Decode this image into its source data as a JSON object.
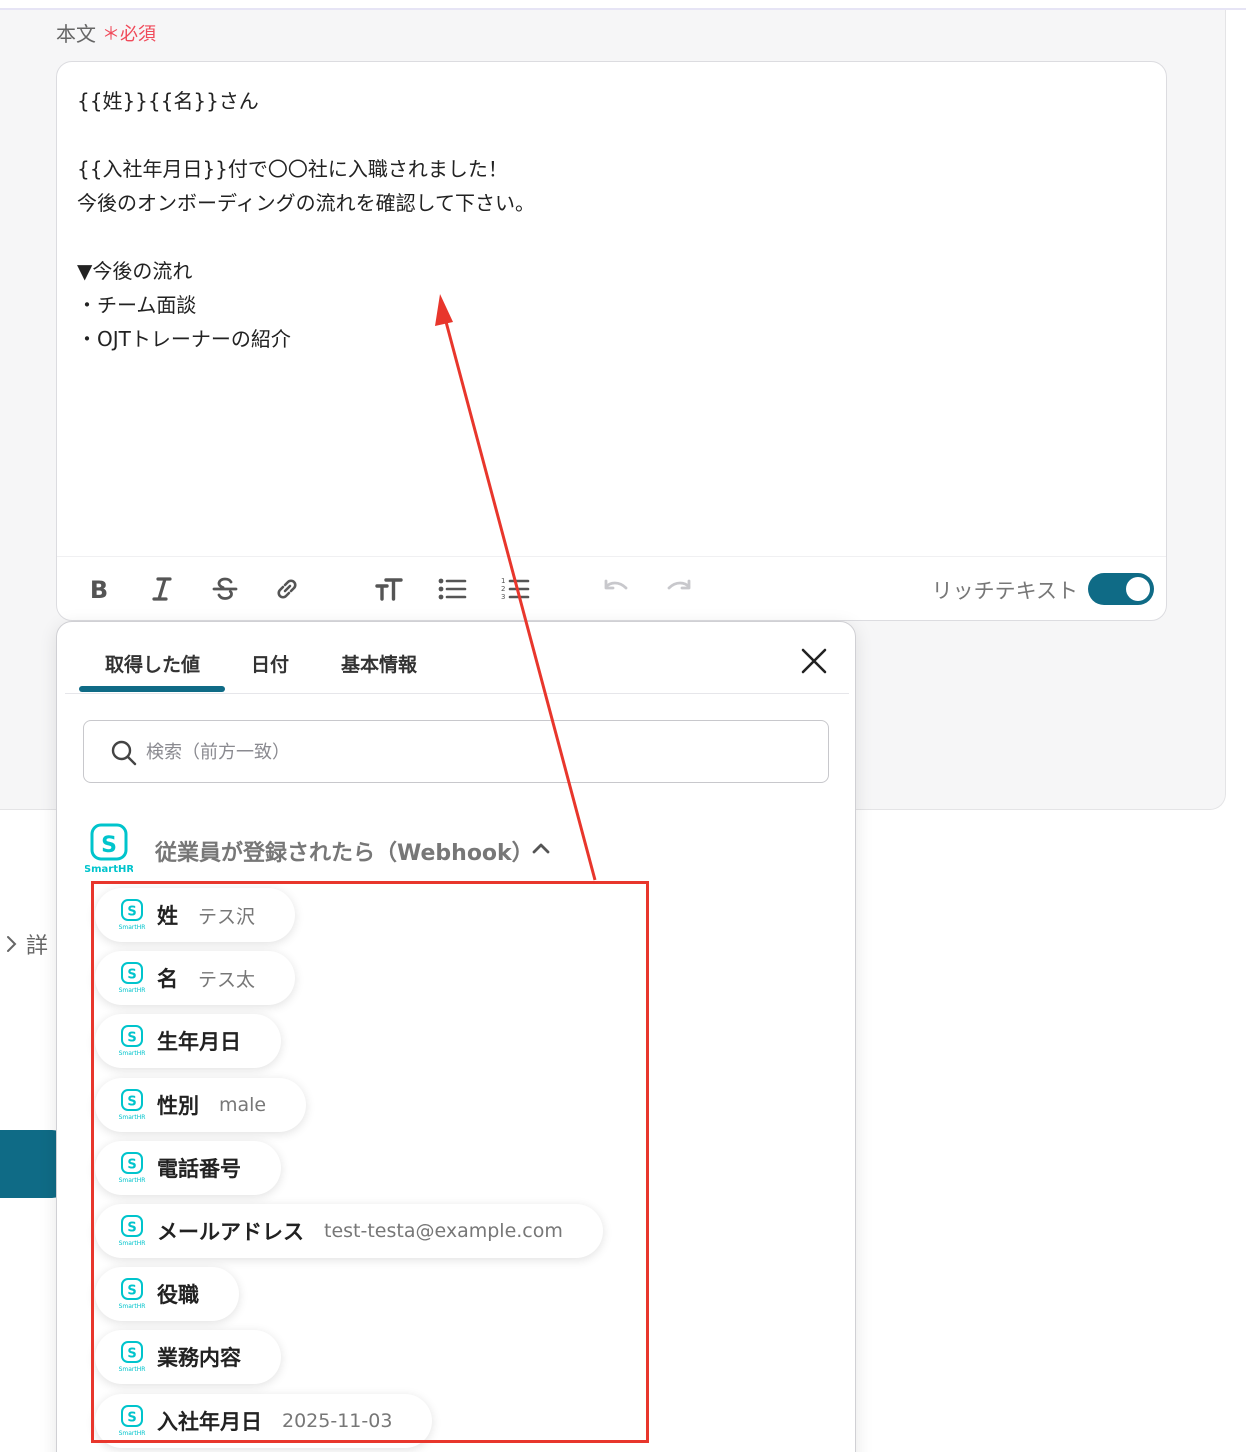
{
  "field": {
    "label": "本文",
    "required": "必須"
  },
  "editor": {
    "lines": [
      "{{姓}}{{名}}さん",
      "",
      "{{入社年月日}}付で〇〇社に入職されました！",
      "今後のオンボーディングの流れを確認して下さい。",
      "",
      "▼今後の流れ",
      "・チーム面談",
      "・OJTトレーナーの紹介"
    ],
    "rich_text_label": "リッチテキスト",
    "rich_text_on": true
  },
  "details_label": "詳",
  "popup": {
    "tabs": [
      {
        "label": "取得した値",
        "active": true
      },
      {
        "label": "日付",
        "active": false
      },
      {
        "label": "基本情報",
        "active": false
      }
    ],
    "search_placeholder": "検索（前方一致）",
    "group": {
      "app": "SmartHR",
      "title": "従業員が登録されたら（Webhook）",
      "items": [
        {
          "key": "姓",
          "value": "テス沢"
        },
        {
          "key": "名",
          "value": "テス太"
        },
        {
          "key": "生年月日",
          "value": ""
        },
        {
          "key": "性別",
          "value": "male"
        },
        {
          "key": "電話番号",
          "value": ""
        },
        {
          "key": "メールアドレス",
          "value": "test-testa@example.com"
        },
        {
          "key": "役職",
          "value": ""
        },
        {
          "key": "業務内容",
          "value": ""
        },
        {
          "key": "入社年月日",
          "value": "2025-11-03"
        }
      ]
    }
  },
  "colors": {
    "accent": "#0f6b86",
    "required": "#f04a5a",
    "annotation": "#e8362c",
    "smarthr": "#00c4cc"
  }
}
